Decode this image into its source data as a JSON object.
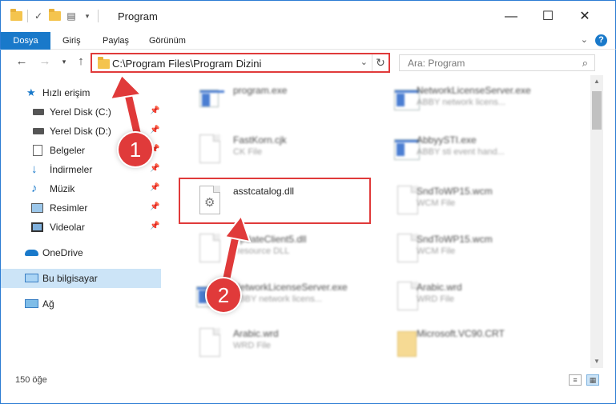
{
  "window": {
    "title": "Program",
    "minimize_glyph": "—",
    "maximize_glyph": "☐",
    "close_glyph": "✕"
  },
  "ribbon": {
    "tabs": [
      {
        "label": "Dosya",
        "active": true
      },
      {
        "label": "Giriş"
      },
      {
        "label": "Paylaş"
      },
      {
        "label": "Görünüm"
      }
    ],
    "help_glyph": "?",
    "expand_glyph": "⌄"
  },
  "address": {
    "path": "C:\\Program Files\\Program Dizini",
    "search_placeholder": "Ara: Program"
  },
  "nav": {
    "items": [
      {
        "label": "Hızlı erişim",
        "icon": "star-icon"
      },
      {
        "label": "Yerel Disk (C:)",
        "icon": "drive-icon",
        "pinned": true
      },
      {
        "label": "Yerel Disk (D:)",
        "icon": "drive-icon",
        "pinned": true
      },
      {
        "label": "Belgeler",
        "icon": "documents-icon",
        "pinned": true
      },
      {
        "label": "İndirmeler",
        "icon": "download-icon",
        "pinned": true
      },
      {
        "label": "Müzik",
        "icon": "music-icon",
        "pinned": true
      },
      {
        "label": "Resimler",
        "icon": "pictures-icon",
        "pinned": true
      },
      {
        "label": "Videolar",
        "icon": "videos-icon",
        "pinned": true
      },
      {
        "label": "OneDrive",
        "icon": "cloud-icon"
      },
      {
        "label": "Bu bilgisayar",
        "icon": "computer-icon",
        "selected": true
      },
      {
        "label": "Ağ",
        "icon": "network-icon"
      }
    ]
  },
  "files": [
    {
      "name": "program.exe",
      "type": "",
      "icon": "exe-icon"
    },
    {
      "name": "NetworkLicenseServer.exe",
      "type": "ABBY network licens...",
      "icon": "app-window-icon"
    },
    {
      "name": "FastKorn.cjk",
      "type": "CK File",
      "icon": "file-icon"
    },
    {
      "name": "AbbyySTI.exe",
      "type": "ABBY sti event hand...",
      "icon": "app-window-icon"
    },
    {
      "name": "asstcatalog.dll",
      "type": "",
      "icon": "dll-icon",
      "highlight": true
    },
    {
      "name": "SndToWP15.wcm",
      "type": "WCM File",
      "icon": "file-icon"
    },
    {
      "name": "UpdateClient5.dll",
      "type": "Resource DLL",
      "icon": "dll-icon"
    },
    {
      "name": "SndToWP15.wcm",
      "type": "WCM File",
      "icon": "file-icon"
    },
    {
      "name": "NetworkLicenseServer.exe",
      "type": "ABBY network licens...",
      "icon": "app-window-icon"
    },
    {
      "name": "Arabic.wrd",
      "type": "WRD File",
      "icon": "file-icon"
    },
    {
      "name": "Arabic.wrd",
      "type": "WRD File",
      "icon": "file-icon"
    },
    {
      "name": "Microsoft.VC90.CRT",
      "type": "",
      "icon": "folder-icon"
    }
  ],
  "status": {
    "item_count": "150 öğe"
  },
  "callouts": {
    "one": "1",
    "two": "2"
  },
  "colors": {
    "accent": "#1979ca",
    "highlight_red": "#e03a3a",
    "selection": "#cce4f7"
  }
}
